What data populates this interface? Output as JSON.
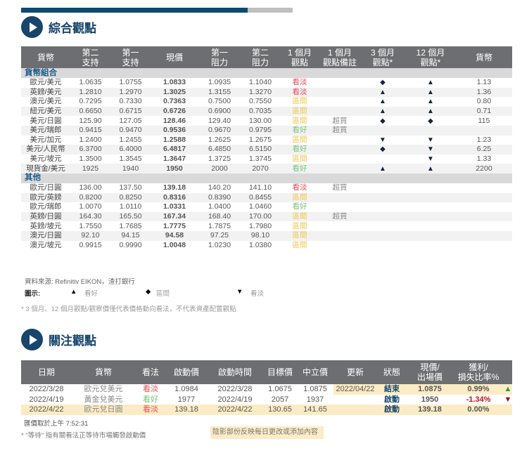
{
  "progress": {
    "fraction": 0.83,
    "fill": "#0d4a6e",
    "track": "#bfbfbf"
  },
  "section1": {
    "title": "綜合觀點",
    "headers": [
      "貨幣",
      "第二\n支持",
      "第一\n支持",
      "現價",
      "第一\n阻力",
      "第二\n阻力",
      "1 個月\n觀點",
      "1 個月\n觀點備註",
      "3 個月\n觀點*",
      "12 個月\n觀點*",
      "貨幣"
    ],
    "groups": [
      {
        "name": "貨幣組合",
        "rows": [
          [
            "歐元/美元",
            "1.0635",
            "1.0755",
            "1.0833",
            "1.0935",
            "1.1040",
            "看淡",
            "",
            "◆",
            "▲",
            "1.13"
          ],
          [
            "英鎊/美元",
            "1.2810",
            "1.2970",
            "1.3025",
            "1.3155",
            "1.3270",
            "看淡",
            "",
            "▲",
            "▲",
            "1.36"
          ],
          [
            "澳元/美元",
            "0.7295",
            "0.7330",
            "0.7363",
            "0.7500",
            "0.7550",
            "區間",
            "",
            "▲",
            "▲",
            "0.80"
          ],
          [
            "紐元/美元",
            "0.6650",
            "0.6715",
            "0.6726",
            "0.6900",
            "0.7035",
            "區間",
            "",
            "▲",
            "▲",
            "0.71"
          ],
          [
            "美元/日圓",
            "125.90",
            "127.05",
            "128.46",
            "129.40",
            "130.00",
            "區間",
            "超買",
            "◆",
            "◆",
            "115"
          ],
          [
            "美元/瑞郎",
            "0.9415",
            "0.9470",
            "0.9536",
            "0.9670",
            "0.9795",
            "看好",
            "超買",
            "",
            "",
            ""
          ],
          [
            "美元/加元",
            "1.2400",
            "1.2455",
            "1.2588",
            "1.2625",
            "1.2675",
            "區間",
            "",
            "▼",
            "▼",
            "1.23"
          ],
          [
            "美元/人民幣",
            "6.3700",
            "6.4000",
            "6.4817",
            "6.4850",
            "6.5150",
            "看好",
            "",
            "◆",
            "▼",
            "6.25"
          ],
          [
            "美元/坡元",
            "1.3500",
            "1.3545",
            "1.3647",
            "1.3725",
            "1.3745",
            "區間",
            "",
            "",
            "▼",
            "1.33"
          ],
          [
            "現貨金/美元",
            "1925",
            "1940",
            "1950",
            "2000",
            "2070",
            "看好",
            "",
            "▲",
            "▲",
            "2200"
          ]
        ]
      },
      {
        "name": "其他",
        "rows": [
          [
            "歐元/日圓",
            "136.00",
            "137.50",
            "139.18",
            "140.20",
            "141.10",
            "看淡",
            "超買",
            "",
            "",
            ""
          ],
          [
            "歐元/英鎊",
            "0.8200",
            "0.8250",
            "0.8316",
            "0.8390",
            "0.8455",
            "區間",
            "",
            "",
            "",
            ""
          ],
          [
            "歐元/瑞郎",
            "1.0070",
            "1.0110",
            "1.0331",
            "1.0400",
            "1.0460",
            "看好",
            "",
            "",
            "",
            ""
          ],
          [
            "英鎊/日圓",
            "164.30",
            "165.50",
            "167.34",
            "168.40",
            "170.00",
            "區間",
            "超買",
            "",
            "",
            ""
          ],
          [
            "英鎊/坡元",
            "1.7550",
            "1.7685",
            "1.7775",
            "1.7875",
            "1.7980",
            "區間",
            "",
            "",
            "",
            ""
          ],
          [
            "澳元/日圓",
            "92.10",
            "94.15",
            "94.58",
            "97.25",
            "98.10",
            "區間",
            "",
            "",
            "",
            ""
          ],
          [
            "澳元/坡元",
            "0.9915",
            "0.9990",
            "1.0048",
            "1.0230",
            "1.0380",
            "區間",
            "",
            "",
            "",
            ""
          ]
        ]
      }
    ],
    "source": "資料來源: Refinitiv EIKON，渣打銀行",
    "legend": {
      "label": "圖示:",
      "items": [
        {
          "sym": "▲",
          "text": "看好"
        },
        {
          "sym": "◆",
          "text": "區間"
        },
        {
          "sym": "▼",
          "text": "看淡"
        }
      ]
    },
    "footnote": "* 3 個月、12 個月觀點/觀察價僅代表價格動向看法，不代表資產配置觀點"
  },
  "section2": {
    "title": "關注觀點",
    "headers": [
      "日期",
      "貨幣",
      "看法",
      "啟動價",
      "啟動時間",
      "目標價",
      "中立價",
      "更新",
      "狀態",
      "現價/\n出場價",
      "獲利/\n損失比率%",
      ""
    ],
    "rows": [
      [
        "2022/3/28",
        "歐元兌美元",
        "看淡",
        "1.0984",
        "2022/3/28",
        "1.0675",
        "1.0875",
        "2022/04/22",
        "結束",
        "1.0875",
        "0.99%",
        "▲"
      ],
      [
        "2022/4/19",
        "黃金兌美元",
        "看好",
        "1977",
        "2022/4/19",
        "2057",
        "1937",
        "",
        "啟動",
        "1950",
        "-1.34%",
        "▼"
      ],
      [
        "2022/4/22",
        "歐元兌日圓",
        "看淡",
        "139.18",
        "2022/4/22",
        "130.65",
        "141.65",
        "",
        "啟動",
        "139.18",
        "0.00%",
        ""
      ]
    ],
    "quote_time": "匯價取於上午 7:52:31",
    "footnote": "* \"等待\" 指有關看法正等待市場觸發啟動價",
    "shade_note": "陰影部份反映每日更改或添加內容"
  }
}
